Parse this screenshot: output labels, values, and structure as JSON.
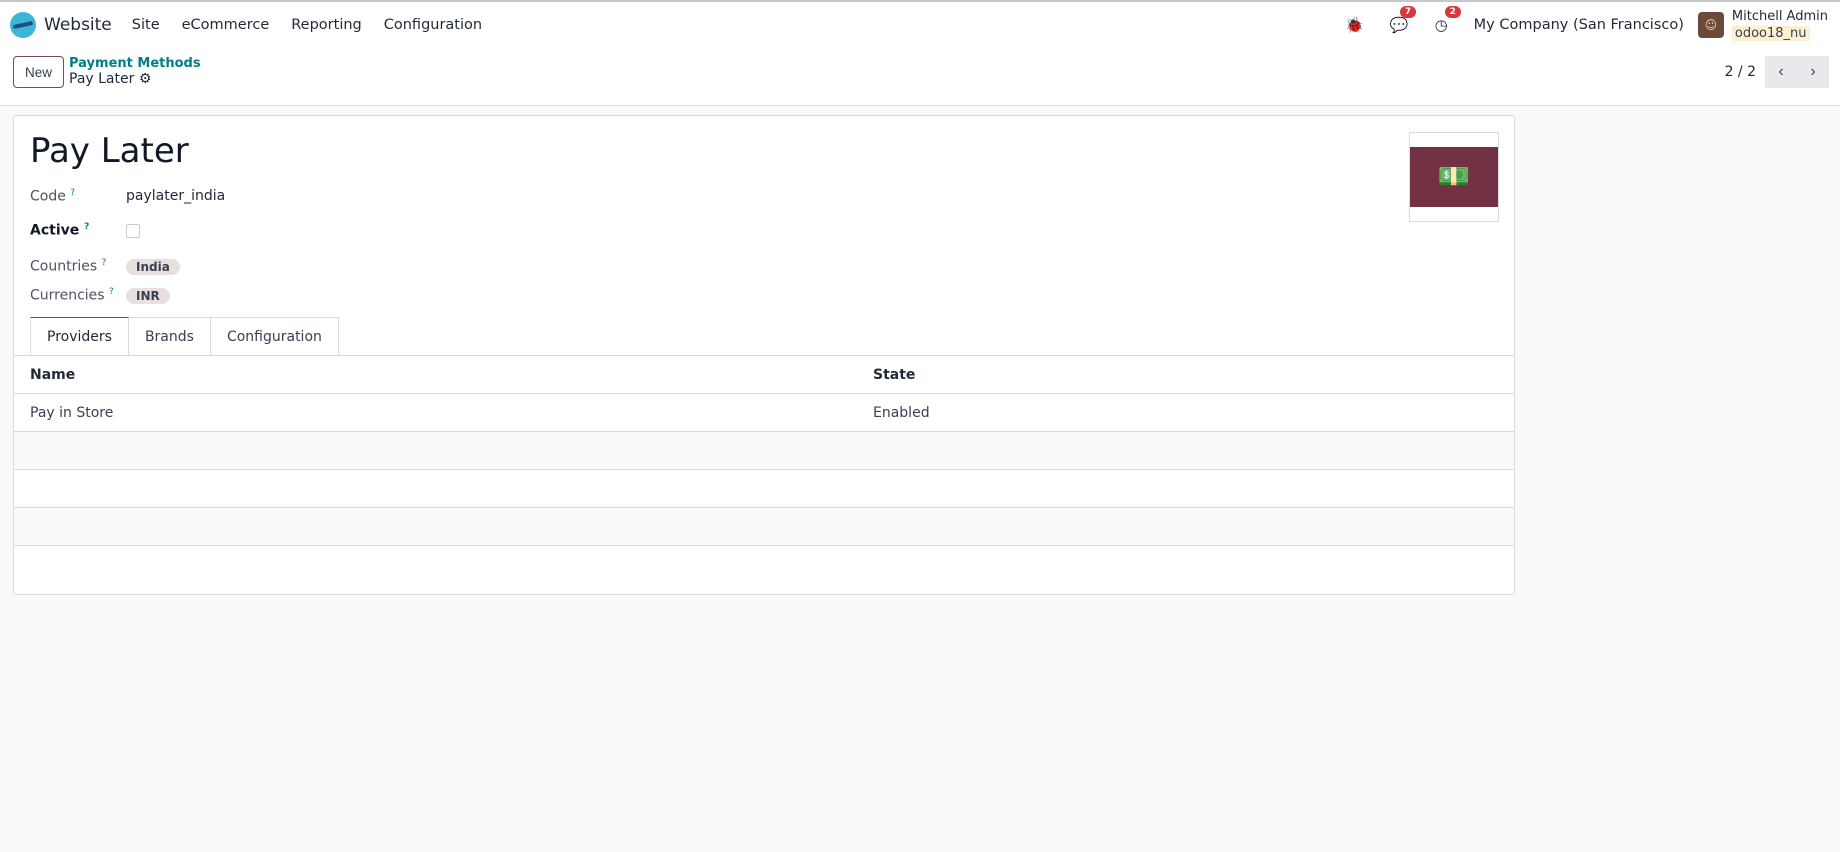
{
  "nav": {
    "app": "Website",
    "menu": [
      "Site",
      "eCommerce",
      "Reporting",
      "Configuration"
    ],
    "messages_count": "7",
    "activities_count": "2",
    "company": "My Company (San Francisco)",
    "user": "Mitchell Admin",
    "database": "odoo18_nu"
  },
  "control": {
    "new_label": "New",
    "breadcrumb_parent": "Payment Methods",
    "breadcrumb_current": "Pay Later",
    "pager": "2 / 2"
  },
  "form": {
    "title": "Pay Later",
    "code_label": "Code",
    "code_value": "paylater_india",
    "active_label": "Active",
    "active": false,
    "countries_label": "Countries",
    "countries": [
      "India"
    ],
    "currencies_label": "Currencies",
    "currencies": [
      "INR"
    ],
    "help_mark": "?",
    "tabs": [
      "Providers",
      "Brands",
      "Configuration"
    ],
    "active_tab": "Providers",
    "table": {
      "headers": [
        "Name",
        "State"
      ],
      "rows": [
        [
          "Pay in Store",
          "Enabled"
        ]
      ]
    }
  },
  "colors": {
    "brand": "#714b67",
    "link": "#017e84",
    "image_bg": "#733244",
    "badge": "#d9363e"
  }
}
